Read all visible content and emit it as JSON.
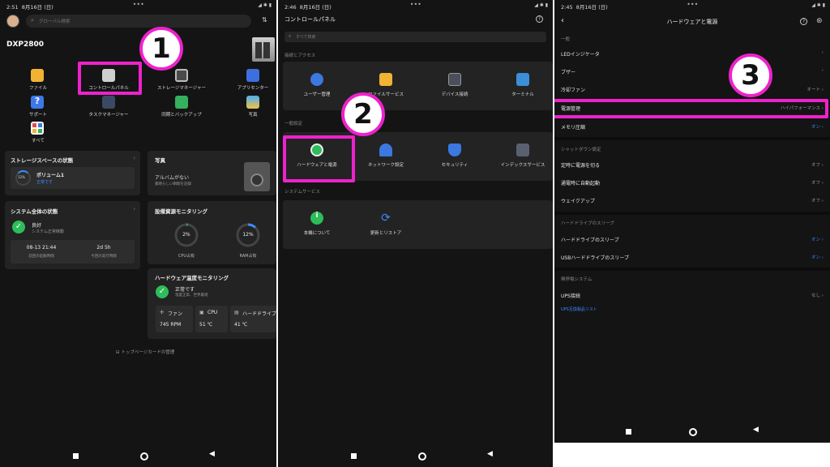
{
  "p1": {
    "time": "2:51",
    "date": "8月16日 (日)",
    "search_placeholder": "グローバル検索",
    "device": "DXP2800",
    "apps": [
      "ファイル",
      "コントロールパネル",
      "ストレージマネージャー",
      "アプリセンター",
      "サポート",
      "タスクマネージャー",
      "同期とバックアップ",
      "写真",
      "すべて"
    ],
    "storage": {
      "title": "ストレージスペースの状態",
      "volume": "ボリューム1",
      "status": "正常です",
      "percent": "12%"
    },
    "system": {
      "title": "システム全体の状態",
      "status": "良好",
      "desc": "システム正常稼動",
      "boot": "08-13 21:44",
      "boot_label": "前回の起動時間",
      "uptime": "2d 5h",
      "uptime_label": "今回の実行時間"
    },
    "photo": {
      "title": "写真",
      "none": "アルバムがない",
      "desc": "素晴らしい瞬間を記録"
    },
    "resources": {
      "title": "設備資源モニタリング",
      "cpu": "2%",
      "cpu_label": "CPU占有",
      "cpu_value": 0.02,
      "ram": "12%",
      "ram_label": "RAM占有",
      "ram_value": 0.12
    },
    "hw": {
      "title": "ハードウェア温度モニタリング",
      "status": "正常です",
      "desc": "温度正常、世界最適",
      "fan": "ファン",
      "fan_val": "745 RPM",
      "cpu": "CPU",
      "cpu_val": "51 ℃",
      "hdd": "ハードドライブ",
      "hdd_val": "41 ℃"
    },
    "manage": "トップページカードの管理",
    "marker": "1"
  },
  "p2": {
    "time": "2:46",
    "date": "8月16日 (日)",
    "title": "コントロールパネル",
    "search_placeholder": "すべて検索",
    "sec1": "接続とアクセス",
    "sec1_items": [
      "ユーザー管理",
      "ファイルサービス",
      "デバイス接続",
      "ターミナル"
    ],
    "sec2": "一般設定",
    "sec2_items": [
      "ハードウェアと電源",
      "ネットワーク設定",
      "セキュリティ",
      "インデックスサービス"
    ],
    "sec3": "システムサービス",
    "sec3_items": [
      "本機について",
      "更新とリストア"
    ],
    "marker": "2"
  },
  "p3": {
    "time": "2:45",
    "date": "8月16日 (日)",
    "title": "ハードウェアと電源",
    "sec_general": "一般",
    "general": [
      {
        "label": "LEDインジケータ",
        "value": ""
      },
      {
        "label": "ブザー",
        "value": ""
      },
      {
        "label": "冷却ファン",
        "value": "オート"
      },
      {
        "label": "電源管理",
        "value": "ハイパフォーマンス"
      },
      {
        "label": "メモリ圧縮",
        "value": "オン"
      }
    ],
    "sec_shutdown": "シャットダウン設定",
    "shutdown": [
      {
        "label": "定時に電源を切る",
        "value": "オフ"
      },
      {
        "label": "通電時に自動起動",
        "value": "オフ"
      },
      {
        "label": "ウェイクアップ",
        "value": "オフ"
      }
    ],
    "sec_hdd": "ハードドライブのスリープ",
    "hdd": [
      {
        "label": "ハードドライブのスリープ",
        "value": "オン"
      },
      {
        "label": "USBハードドライブのスリープ",
        "value": "オン"
      }
    ],
    "sec_ups": "無停電システム",
    "ups": [
      {
        "label": "UPS接続",
        "value": "なし"
      }
    ],
    "ups_link": "UPS互換製品リスト",
    "marker": "3"
  },
  "colors": {
    "accent": "#3b8bff",
    "highlight": "#ee22cc",
    "ok": "#2dbd5a"
  }
}
